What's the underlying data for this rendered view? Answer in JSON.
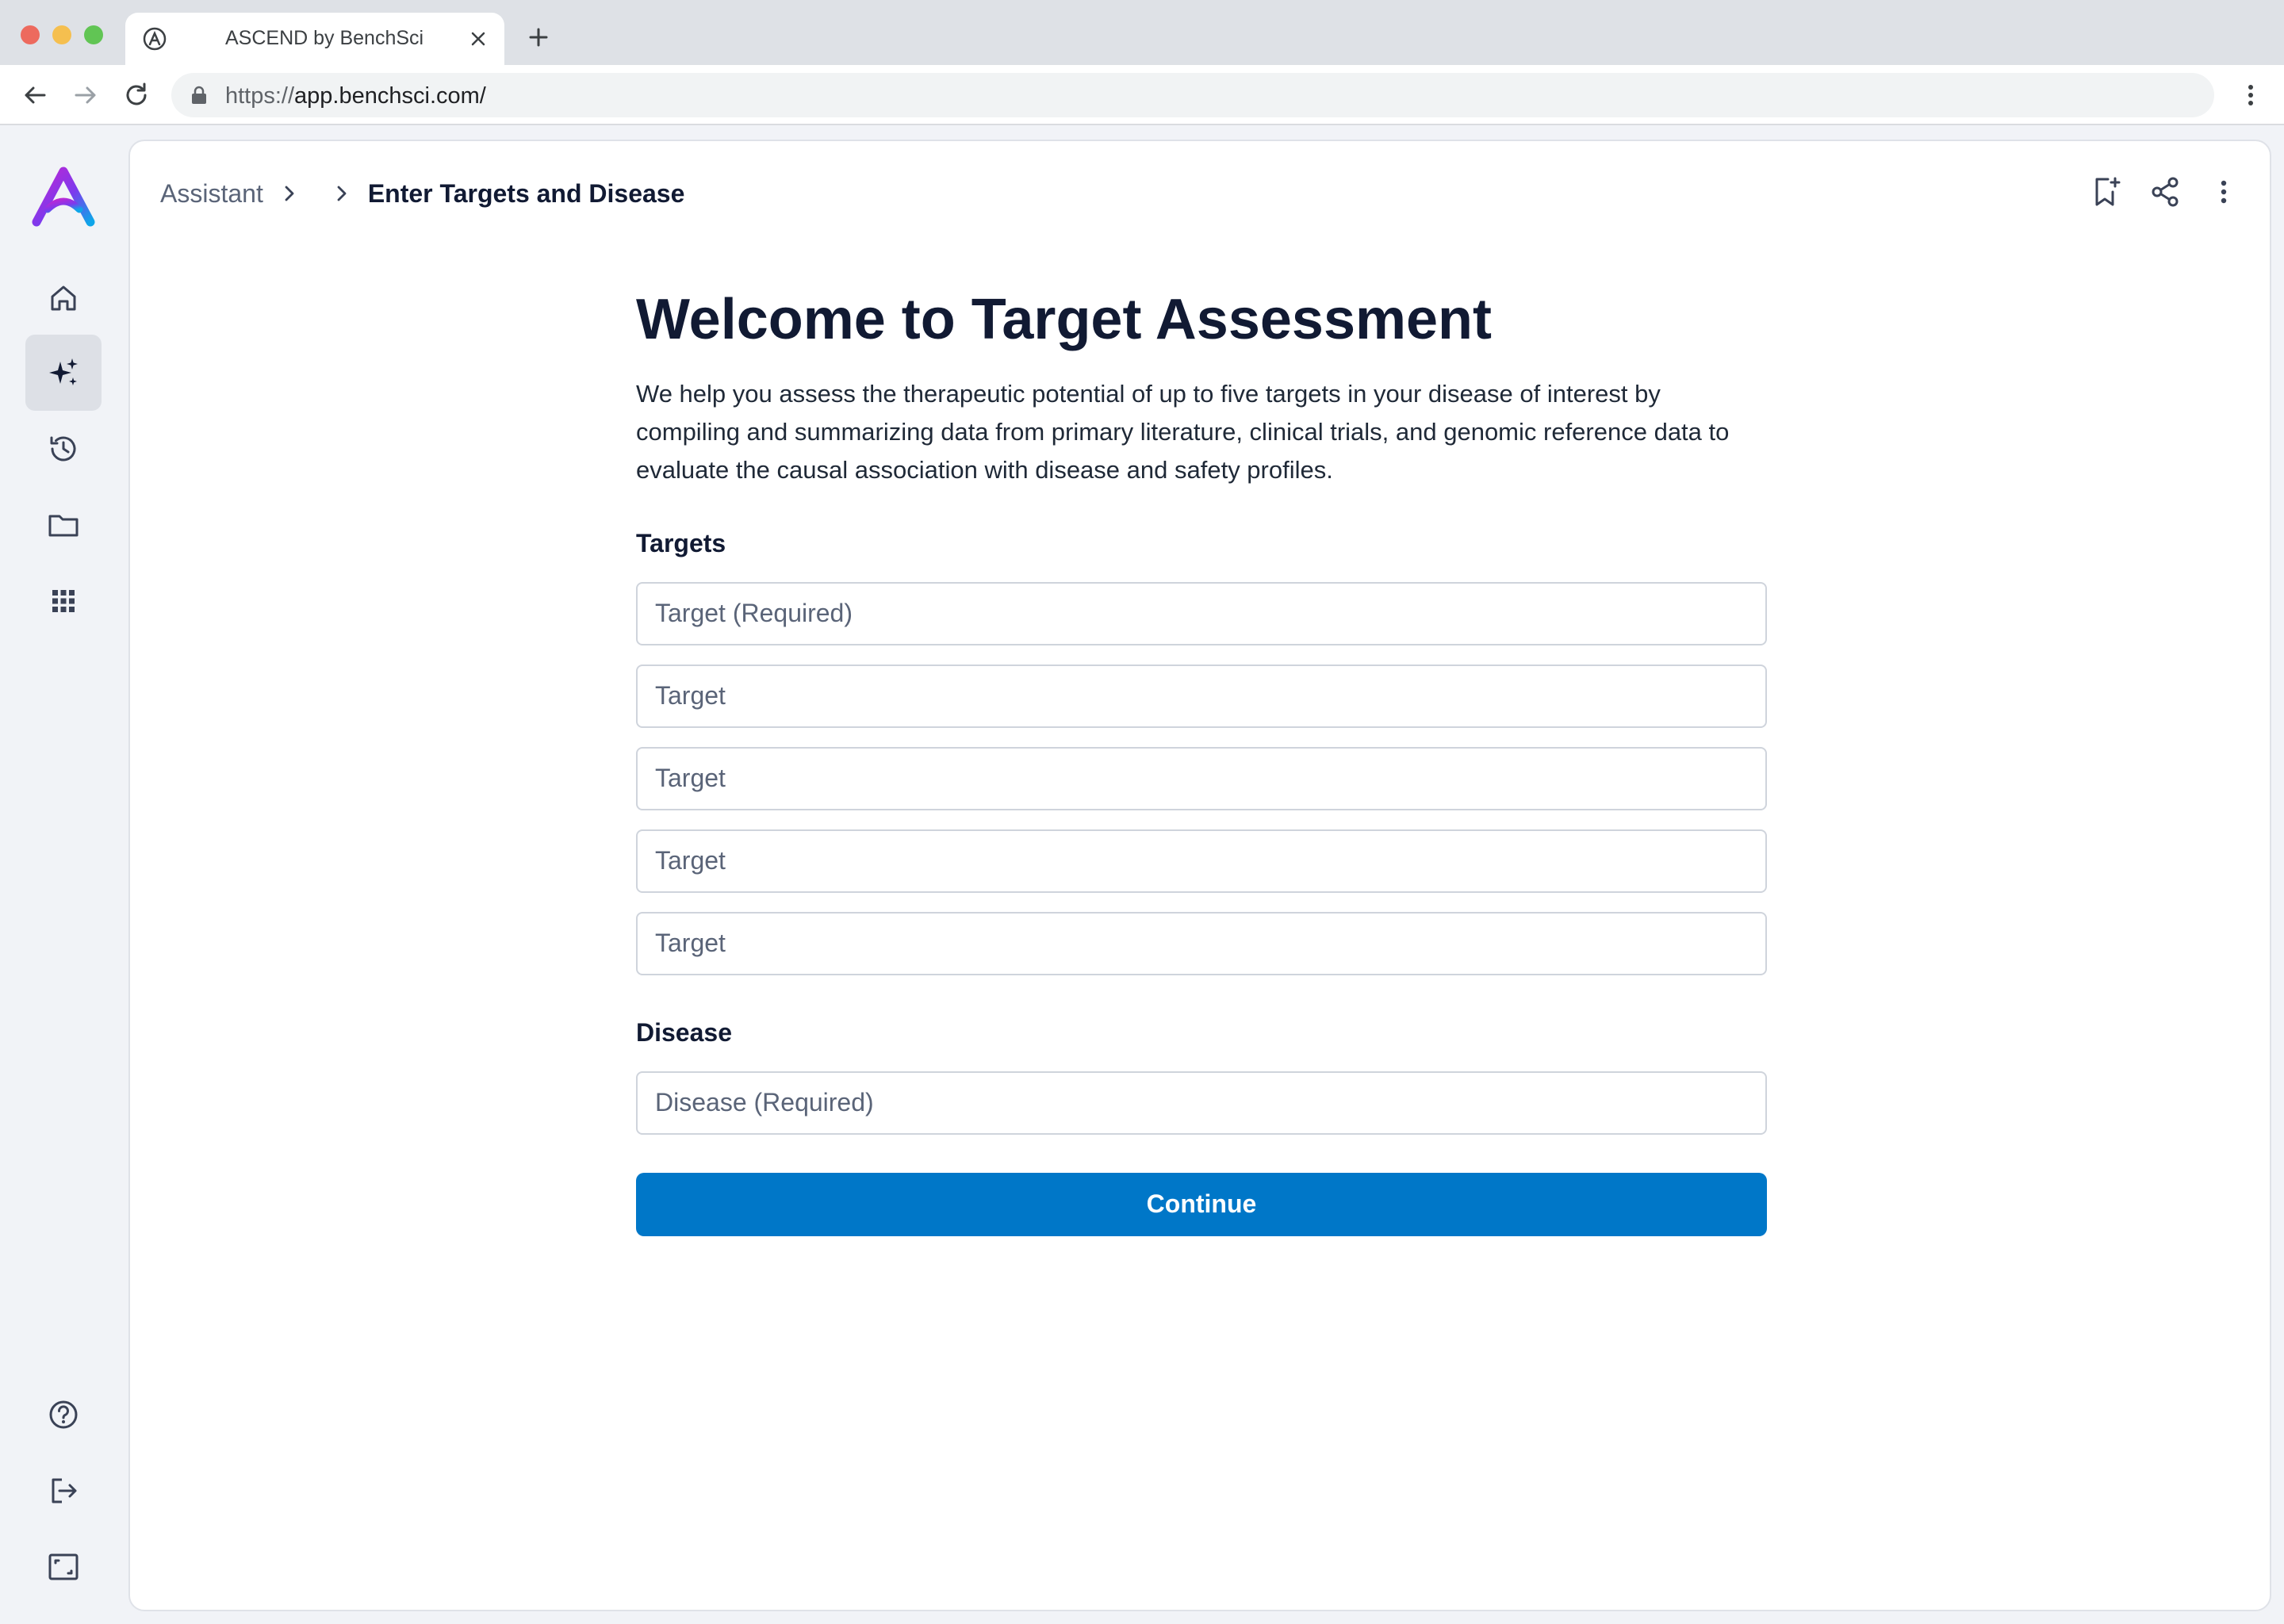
{
  "browser": {
    "tab_title": "ASCEND by BenchSci",
    "url_scheme": "https://",
    "url_host": "app.benchsci.com/"
  },
  "rail": {
    "items": [
      {
        "icon": "home-icon"
      },
      {
        "icon": "sparkles-icon",
        "active": true
      },
      {
        "icon": "history-icon"
      },
      {
        "icon": "folder-icon"
      },
      {
        "icon": "apps-grid-icon"
      }
    ],
    "bottom_items": [
      {
        "icon": "help-icon"
      },
      {
        "icon": "logout-icon"
      },
      {
        "icon": "collapse-icon"
      }
    ]
  },
  "breadcrumb": {
    "root": "Assistant",
    "current": "Enter Targets and Disease"
  },
  "main": {
    "title": "Welcome to Target Assessment",
    "intro": "We help you assess the therapeutic potential of up to five targets in your disease of interest by compiling and summarizing data from primary literature, clinical trials, and genomic reference data to evaluate the causal association with disease and safety profiles.",
    "targets_label": "Targets",
    "target_fields": [
      {
        "placeholder": "Target (Required)",
        "value": ""
      },
      {
        "placeholder": "Target",
        "value": ""
      },
      {
        "placeholder": "Target",
        "value": ""
      },
      {
        "placeholder": "Target",
        "value": ""
      },
      {
        "placeholder": "Target",
        "value": ""
      }
    ],
    "disease_label": "Disease",
    "disease_field": {
      "placeholder": "Disease (Required)",
      "value": ""
    },
    "continue_label": "Continue"
  },
  "colors": {
    "primary": "#0077c8",
    "text_dark": "#111a33",
    "rail_active": "#dde0e6"
  }
}
